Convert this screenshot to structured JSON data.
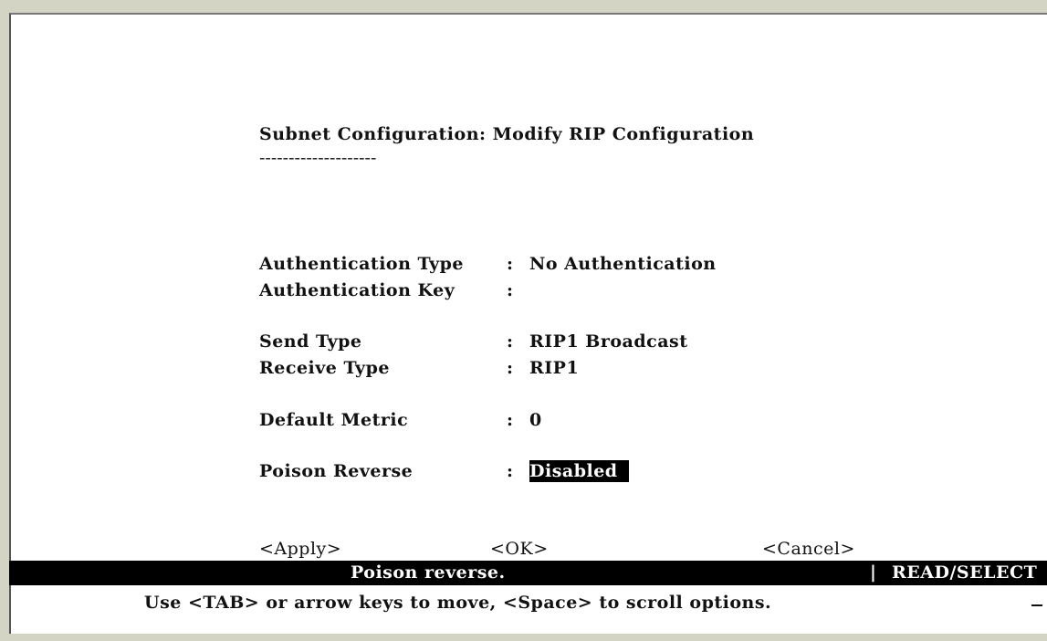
{
  "screen": {
    "title": "Subnet Configuration: Modify RIP Configuration",
    "title_underline": "--------------------",
    "fields": [
      {
        "label": "Authentication Type",
        "sep": ":",
        "value": "No Authentication"
      },
      {
        "label": "Authentication Key",
        "sep": ":",
        "value": ""
      },
      {
        "label": "Send Type",
        "sep": ":",
        "value": "RIP1 Broadcast"
      },
      {
        "label": "Receive Type",
        "sep": ":",
        "value": "RIP1"
      },
      {
        "label": "Default Metric",
        "sep": ":",
        "value": "0"
      },
      {
        "label": "Poison Reverse",
        "sep": ":",
        "value": "Disabled"
      }
    ],
    "buttons": {
      "apply": "<Apply>",
      "ok": "<OK>",
      "cancel": "<Cancel>"
    }
  },
  "status_bar": {
    "help": "Poison reverse.",
    "separator": "|",
    "mode": "READ/SELECT"
  },
  "hint": "Use <TAB> or arrow keys to move, <Space> to scroll options."
}
